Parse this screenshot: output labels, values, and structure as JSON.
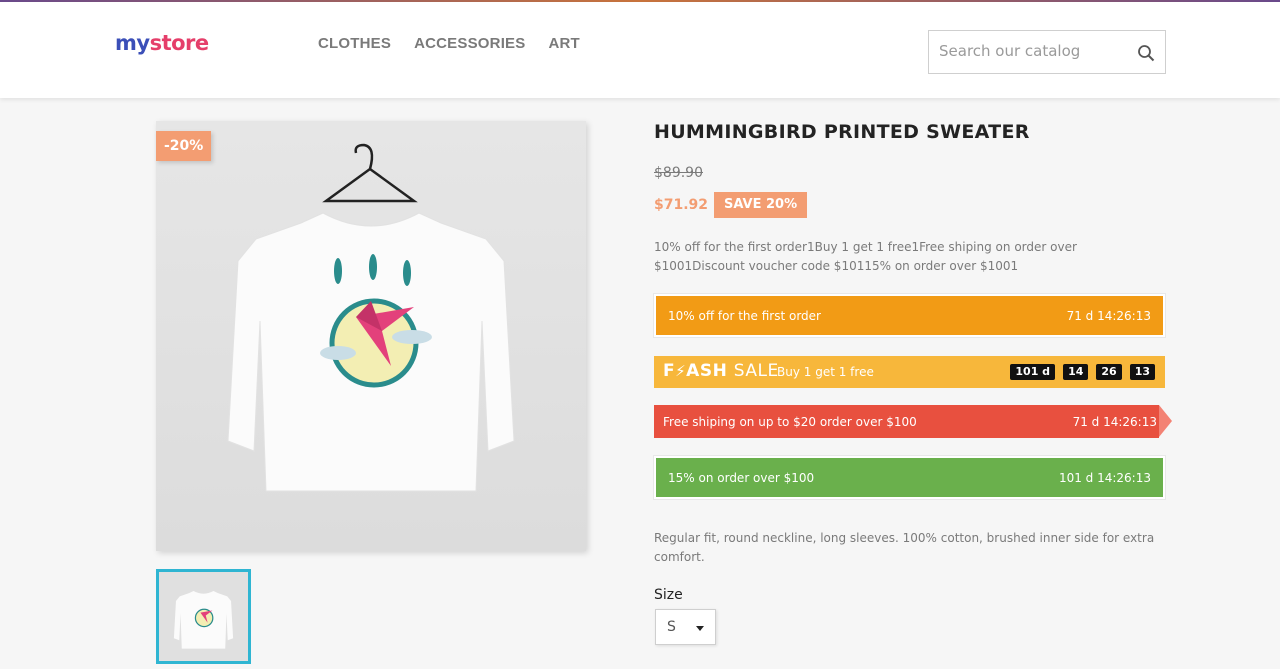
{
  "header": {
    "logo": {
      "text_parts": [
        "my",
        " ",
        "store"
      ]
    },
    "nav": [
      {
        "label": "CLOTHES"
      },
      {
        "label": "ACCESSORIES"
      },
      {
        "label": "ART"
      }
    ],
    "search": {
      "placeholder": "Search our catalog",
      "icon": "search-icon"
    }
  },
  "product": {
    "discount_flag": "-20%",
    "title": "HUMMINGBIRD PRINTED SWEATER",
    "old_price": "$89.90",
    "price": "$71.92",
    "save_badge": "SAVE 20%",
    "promo_summary": "10% off for the first order1Buy 1 get 1 free1Free shiping on order over $1001Discount voucher code $10115% on order over $1001",
    "promos": [
      {
        "label": "10% off for the first order",
        "timer": "71 d 14:26:13",
        "color": "#f29b15"
      },
      {
        "flash_prefix": "F",
        "flash_rest": "ASH",
        "flash_sale": "SALE",
        "label": "Buy 1 get 1 free",
        "chips": [
          "101 d",
          "14",
          "26",
          "13"
        ],
        "color": "#f7b73b"
      },
      {
        "label": "Free shiping on up to $20 order over $100",
        "timer": "71 d 14:26:13",
        "color": "#e8503f"
      },
      {
        "label": "15% on order over $100",
        "timer": "101 d 14:26:13",
        "color": "#6ab04c"
      }
    ],
    "description": "Regular fit, round neckline, long sleeves. 100% cotton, brushed inner side for extra comfort.",
    "size_label": "Size",
    "size_value": "S"
  },
  "colors": {
    "accent": "#f39d72",
    "thumb_border": "#2fb5d2"
  }
}
